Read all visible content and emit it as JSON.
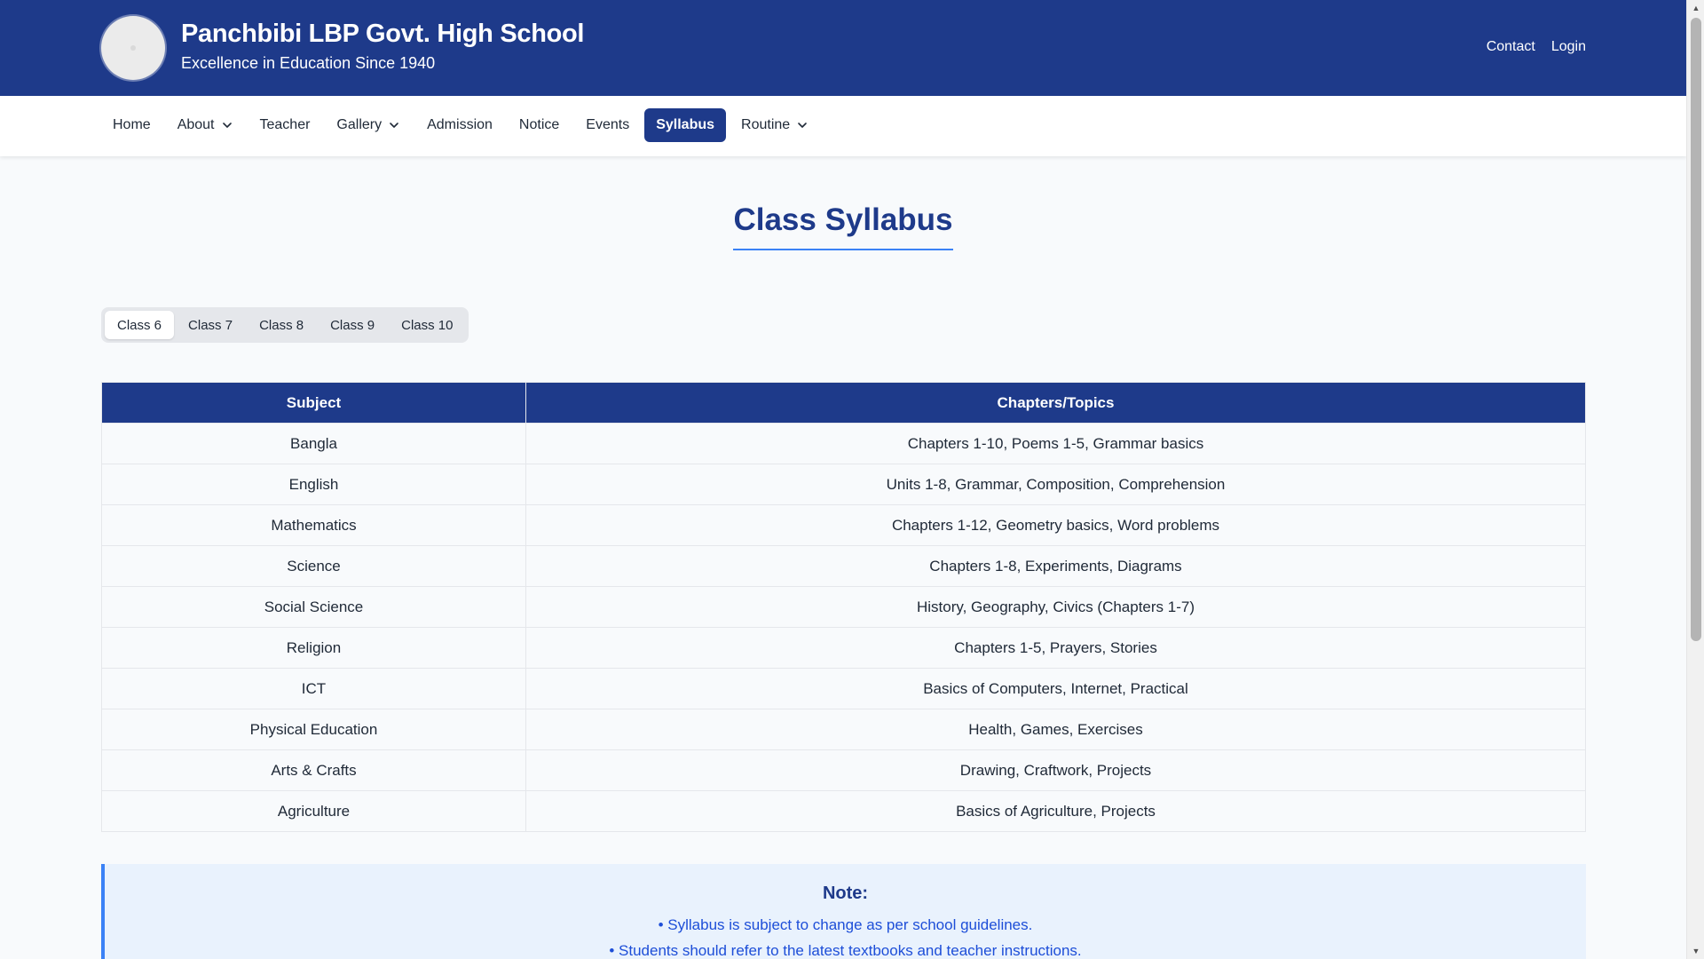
{
  "header": {
    "title": "Panchbibi LBP Govt. High School",
    "subtitle": "Excellence in Education Since 1940",
    "links": [
      {
        "label": "Contact"
      },
      {
        "label": "Login"
      }
    ]
  },
  "nav": {
    "items": [
      {
        "label": "Home",
        "dropdown": false
      },
      {
        "label": "About",
        "dropdown": true
      },
      {
        "label": "Teacher",
        "dropdown": false
      },
      {
        "label": "Gallery",
        "dropdown": true
      },
      {
        "label": "Admission",
        "dropdown": false
      },
      {
        "label": "Notice",
        "dropdown": false
      },
      {
        "label": "Events",
        "dropdown": false
      },
      {
        "label": "Syllabus",
        "dropdown": false,
        "active": true
      },
      {
        "label": "Routine",
        "dropdown": true
      }
    ]
  },
  "main": {
    "heading": "Class Syllabus",
    "tabs": [
      "Class 6",
      "Class 7",
      "Class 8",
      "Class 9",
      "Class 10"
    ],
    "active_tab": "Class 6",
    "table": {
      "headers": [
        "Subject",
        "Chapters/Topics"
      ],
      "rows": [
        [
          "Bangla",
          "Chapters 1-10, Poems 1-5, Grammar basics"
        ],
        [
          "English",
          "Units 1-8, Grammar, Composition, Comprehension"
        ],
        [
          "Mathematics",
          "Chapters 1-12, Geometry basics, Word problems"
        ],
        [
          "Science",
          "Chapters 1-8, Experiments, Diagrams"
        ],
        [
          "Social Science",
          "History, Geography, Civics (Chapters 1-7)"
        ],
        [
          "Religion",
          "Chapters 1-5, Prayers, Stories"
        ],
        [
          "ICT",
          "Basics of Computers, Internet, Practical"
        ],
        [
          "Physical Education",
          "Health, Games, Exercises"
        ],
        [
          "Arts & Crafts",
          "Drawing, Craftwork, Projects"
        ],
        [
          "Agriculture",
          "Basics of Agriculture, Projects"
        ]
      ]
    },
    "note": {
      "title": "Note:",
      "lines": [
        "• Syllabus is subject to change as per school guidelines.",
        "• Students should refer to the latest textbooks and teacher instructions."
      ]
    }
  },
  "colors": {
    "primary": "#1e3a8a",
    "accent": "#3b82f6",
    "note_bg": "#e9f2fd",
    "note_text": "#1d4ed8",
    "page_bg": "#f8fafc"
  },
  "icons": {
    "dropdown": "chevron-down-icon",
    "scroll_up": "scroll-up-arrow-icon",
    "scroll_down": "scroll-down-arrow-icon"
  }
}
